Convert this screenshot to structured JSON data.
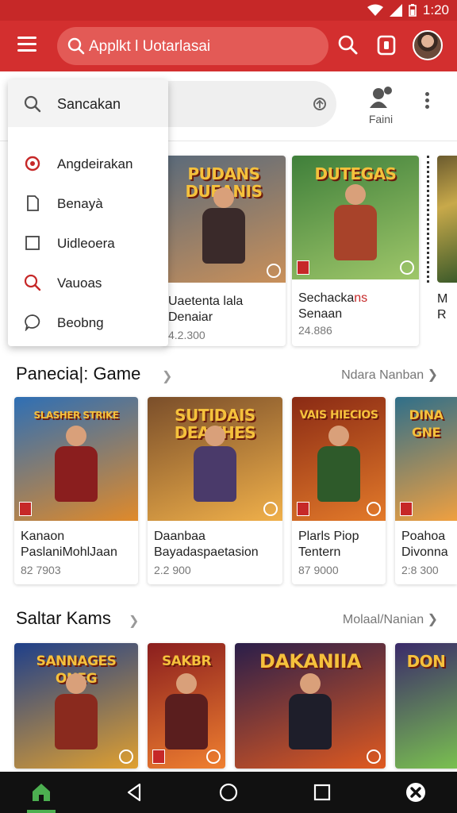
{
  "status_bar": {
    "time": "1:20"
  },
  "app_bar": {
    "search_text": "Applkt l Uotarlasai"
  },
  "search_row": {
    "placeholder": "Sancakan",
    "profile_label": "Faini"
  },
  "dropdown": {
    "search_text": "Sancakan",
    "items": [
      {
        "label": "Angdeirakan",
        "icon": "target-icon"
      },
      {
        "label": "Benayà",
        "icon": "document-icon"
      },
      {
        "label": "Uidleoera",
        "icon": "square-icon"
      },
      {
        "label": "Vauoas",
        "icon": "search-icon"
      },
      {
        "label": "Beobng",
        "icon": "chat-bubble-icon"
      }
    ]
  },
  "featured": {
    "cards": [
      {
        "art_title": "PUDANS DUEANIS",
        "title": "Uaetenta lala",
        "subtitle": "Denaiar",
        "meta": "4.2.300",
        "colors": [
          "#5a6a7a",
          "#c9905a"
        ]
      },
      {
        "art_title": "DUTEGAS",
        "title": "Sechacka",
        "title_accent": "ns",
        "subtitle": "Senaan",
        "meta": "24.886",
        "colors": [
          "#3f7f3a",
          "#9fc76a"
        ]
      },
      {
        "art_title": "",
        "title": "M",
        "subtitle": "R",
        "meta": "",
        "colors": [
          "#6b5b2f",
          "#c8a94a"
        ]
      }
    ]
  },
  "section1": {
    "title": "Panecia|: Game",
    "more": "Ndara Nanban",
    "cards": [
      {
        "art_title": "SLASHER STRIKE",
        "title": "Kanaon",
        "subtitle": "PaslaniMohlJaan",
        "meta": "82 7903",
        "colors": [
          "#2e6fb5",
          "#e08a2a"
        ]
      },
      {
        "art_title": "SUTIDAIS DEAKHES",
        "title": "Daanbaa",
        "subtitle": "Bayadaspaetasion",
        "meta": "2.2 900",
        "colors": [
          "#7a4e2a",
          "#f0b04a"
        ]
      },
      {
        "art_title": "VAIS HIECIOS",
        "title": "Plarls Piop",
        "subtitle": "Tentern",
        "meta": "87 9000",
        "colors": [
          "#8a2a14",
          "#e37a2a"
        ]
      },
      {
        "art_title": "DINA GNE",
        "title": "Poahoa",
        "subtitle": "Divonna",
        "meta": "2:8 300",
        "colors": [
          "#2f6f8a",
          "#f0a040"
        ]
      }
    ]
  },
  "section2": {
    "title": "Saltar Kams",
    "more": "Molaal/Nanian",
    "cards": [
      {
        "art_title": "SANNAGES ONEG",
        "colors": [
          "#1e3f8a",
          "#e0a030"
        ]
      },
      {
        "art_title": "SAKBR",
        "colors": [
          "#8a1e1e",
          "#f08030"
        ]
      },
      {
        "art_title": "DAKANIIA",
        "colors": [
          "#2a1e4a",
          "#e05a20"
        ]
      },
      {
        "art_title": "DON",
        "colors": [
          "#3a2a6a",
          "#7ac050"
        ]
      }
    ]
  },
  "colors": {
    "brand": "#d32f2f",
    "status_bar": "#c62828",
    "nav_bar": "#111111",
    "home_active": "#4caf50"
  }
}
